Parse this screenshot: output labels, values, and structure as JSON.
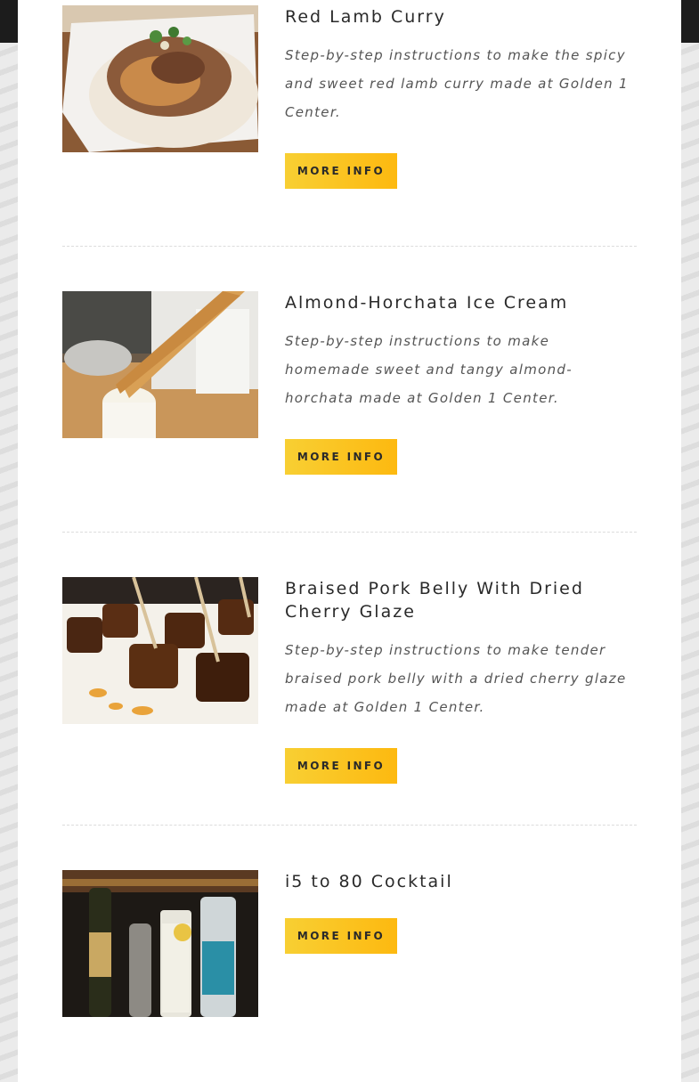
{
  "recipes": [
    {
      "title": "Red Lamb Curry",
      "description": "Step-by-step instructions to make the spicy and sweet red lamb curry made at Golden 1 Center.",
      "button_label": "MORE INFO"
    },
    {
      "title": "Almond-Horchata Ice Cream",
      "description": "Step-by-step instructions to make homemade sweet and tangy almond-horchata made at Golden 1 Center.",
      "button_label": "MORE INFO"
    },
    {
      "title": "Braised Pork Belly With Dried Cherry Glaze",
      "description": "Step-by-step instructions to make tender braised pork belly with a dried cherry glaze made at Golden 1 Center.",
      "button_label": "MORE INFO"
    },
    {
      "title": "i5 to 80 Cocktail",
      "description": "",
      "button_label": "MORE INFO"
    }
  ],
  "colors": {
    "button_gradient_start": "#f8cf33",
    "button_gradient_end": "#fdb910",
    "title_text": "#2a2a2a",
    "description_text": "#555555"
  }
}
